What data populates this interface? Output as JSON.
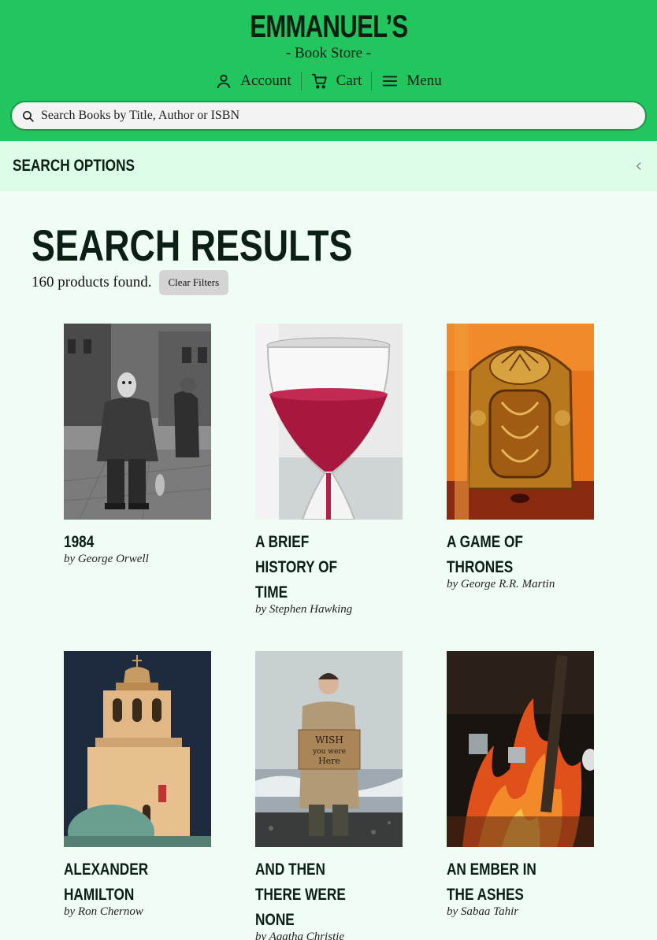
{
  "header": {
    "brand": "EMMANUEL’S",
    "subtitle": "- Book Store -",
    "nav": [
      {
        "label": "Account",
        "icon": "user-icon"
      },
      {
        "label": "Cart",
        "icon": "cart-icon"
      },
      {
        "label": "Menu",
        "icon": "hamburger-icon"
      }
    ],
    "search_placeholder": "Search Books by Title, Author or ISBN"
  },
  "options": {
    "label": "SEARCH OPTIONS",
    "icon": "chevron-left-icon"
  },
  "results": {
    "title": "SEARCH RESULTS",
    "count_text": "160 products found.",
    "clear_label": "Clear Filters"
  },
  "books": [
    {
      "title": "1984",
      "author": "by George Orwell"
    },
    {
      "title": "A BRIEF HISTORY OF TIME",
      "author": "by Stephen Hawking"
    },
    {
      "title": "A GAME OF THRONES",
      "author": "by George R.R. Martin"
    },
    {
      "title": "ALEXANDER HAMILTON",
      "author": "by Ron Chernow"
    },
    {
      "title": "AND THEN THERE WERE NONE",
      "author": "by Agatha Christie"
    },
    {
      "title": "AN EMBER IN THE ASHES",
      "author": "by Sabaa Tahir"
    }
  ],
  "colors": {
    "header": "#22c55e",
    "options_bg": "#dcfce7",
    "page_bg": "#f0fdf4"
  }
}
